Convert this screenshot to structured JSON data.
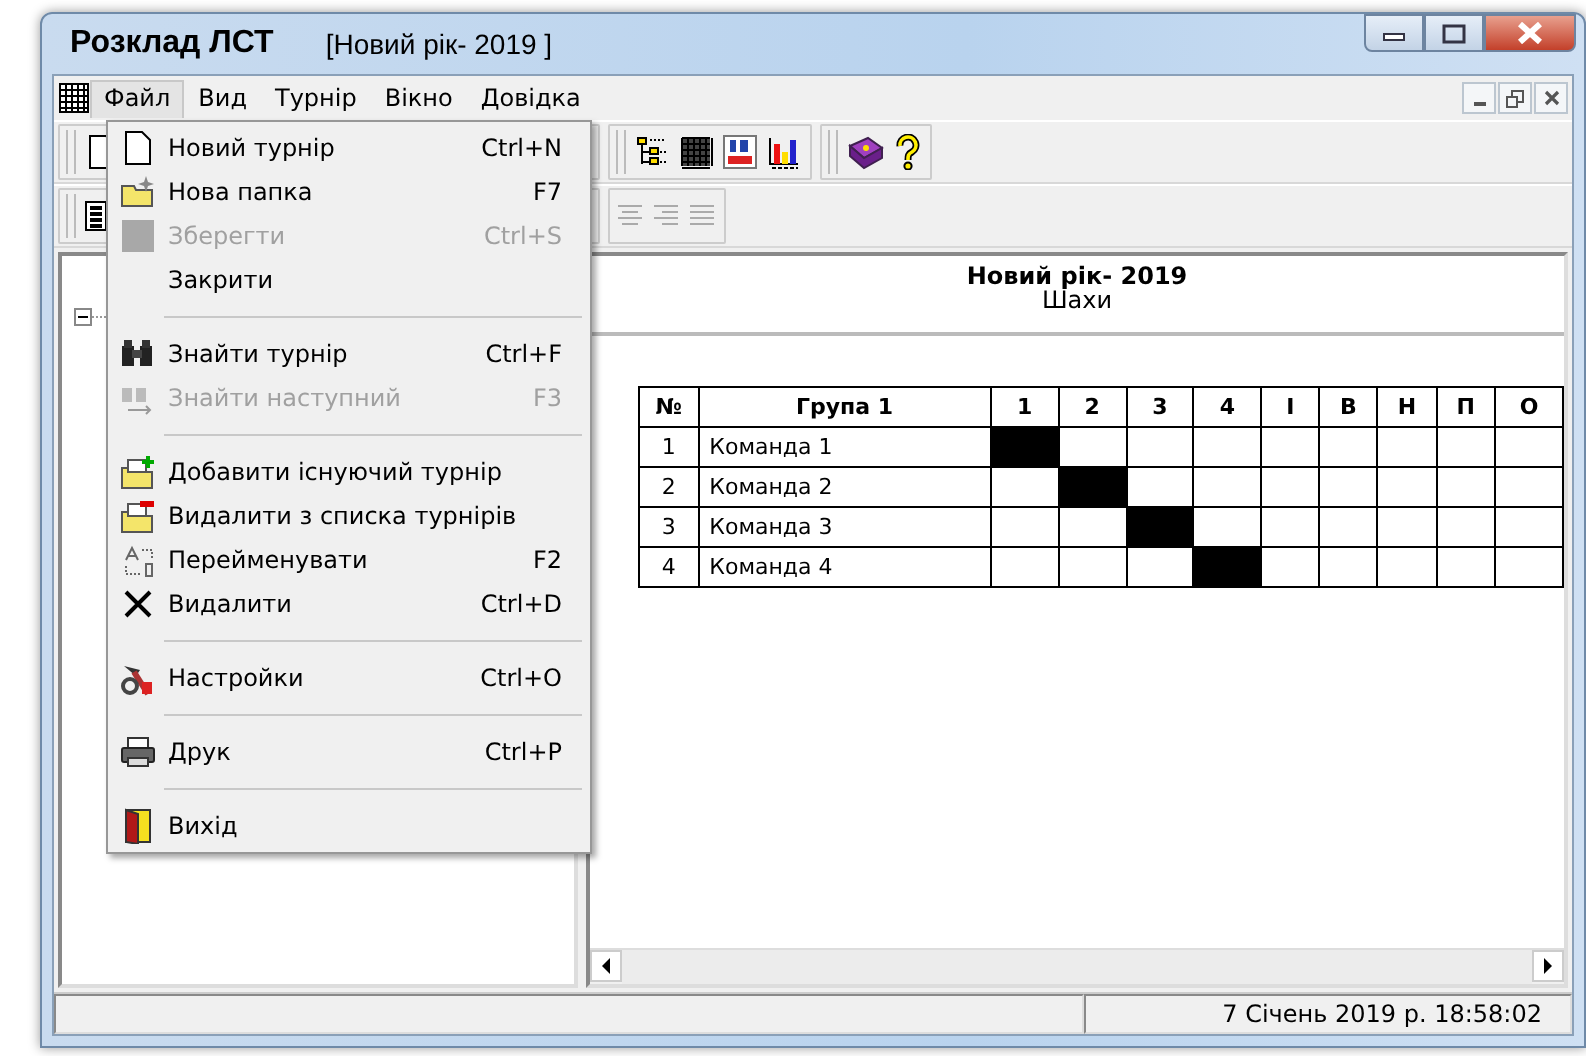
{
  "window": {
    "title": "Розклад ЛСТ",
    "document": "[Новий рік- 2019 ]"
  },
  "menu_bar": [
    {
      "label": "Файл",
      "selected": true
    },
    {
      "label": "Вид",
      "selected": false
    },
    {
      "label": "Турнір",
      "selected": false
    },
    {
      "label": "Вікно",
      "selected": false
    },
    {
      "label": "Довідка",
      "selected": false
    }
  ],
  "file_menu": [
    {
      "kind": "item",
      "label": "Новий турнір",
      "shortcut": "Ctrl+N",
      "disabled": false
    },
    {
      "kind": "item",
      "label": "Нова папка",
      "shortcut": "F7",
      "disabled": false
    },
    {
      "kind": "item",
      "label": "Зберегти",
      "shortcut": "Ctrl+S",
      "disabled": true
    },
    {
      "kind": "item",
      "label": "Закрити",
      "disabled": false
    },
    {
      "kind": "separator"
    },
    {
      "kind": "item",
      "label": "Знайти турнір",
      "shortcut": "Ctrl+F",
      "disabled": false
    },
    {
      "kind": "item",
      "label": "Знайти наступний",
      "shortcut": "F3",
      "disabled": true
    },
    {
      "kind": "separator"
    },
    {
      "kind": "item",
      "label": "Добавити існуючий турнір",
      "disabled": false
    },
    {
      "kind": "item",
      "label": "Видалити з списка турнірів",
      "disabled": false
    },
    {
      "kind": "item",
      "label": "Перейменувати",
      "shortcut": "F2",
      "disabled": false
    },
    {
      "kind": "item",
      "label": "Видалити",
      "shortcut": "Ctrl+D",
      "disabled": false
    },
    {
      "kind": "separator"
    },
    {
      "kind": "item",
      "label": "Настройки",
      "shortcut": "Ctrl+O",
      "disabled": false
    },
    {
      "kind": "separator"
    },
    {
      "kind": "item",
      "label": "Друк",
      "shortcut": "Ctrl+P",
      "disabled": false
    },
    {
      "kind": "separator"
    },
    {
      "kind": "item",
      "label": "Вихід",
      "disabled": false
    }
  ],
  "report": {
    "title": "Новий рік- 2019",
    "subtitle": "Шахи",
    "table": {
      "columns": [
        "№",
        "Група 1",
        "1",
        "2",
        "3",
        "4",
        "I",
        "В",
        "Н",
        "П",
        "О"
      ],
      "rows": [
        {
          "number": "1",
          "team": "Команда 1",
          "blocked": [
            true,
            false,
            false,
            false
          ]
        },
        {
          "number": "2",
          "team": "Команда 2",
          "blocked": [
            false,
            true,
            false,
            false
          ]
        },
        {
          "number": "3",
          "team": "Команда 3",
          "blocked": [
            false,
            false,
            true,
            false
          ]
        },
        {
          "number": "4",
          "team": "Команда 4",
          "blocked": [
            false,
            false,
            false,
            true
          ]
        }
      ]
    }
  },
  "status_bar": {
    "datetime": "7 Січень 2019 р. 18:58:02"
  }
}
